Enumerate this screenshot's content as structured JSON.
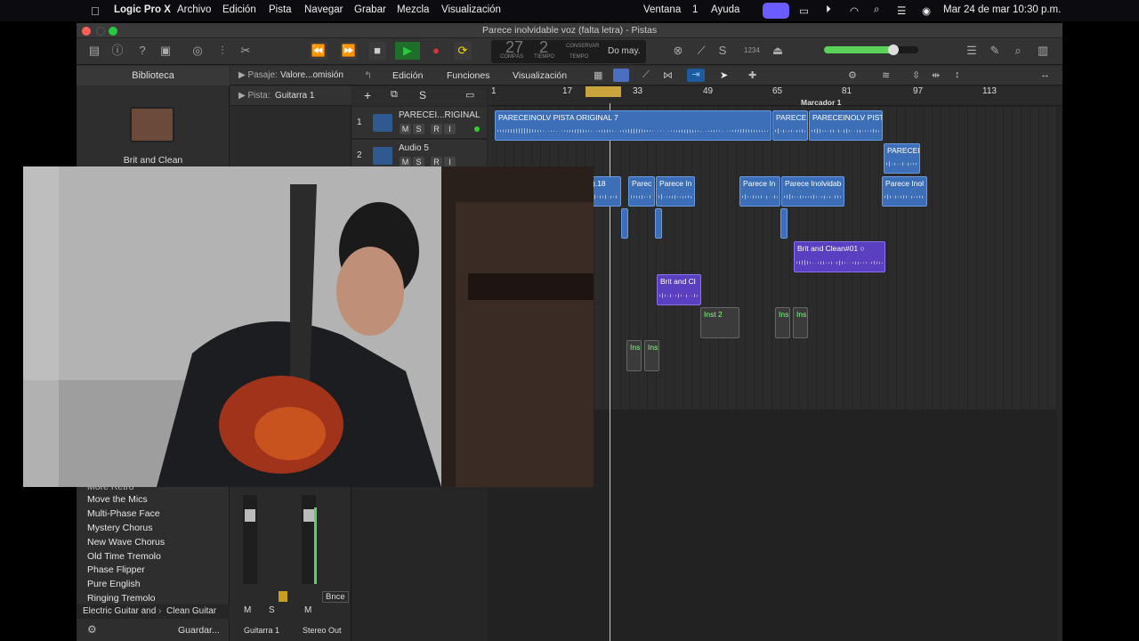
{
  "menubar": {
    "app": "Logic Pro X",
    "items": [
      "Archivo",
      "Edición",
      "Pista",
      "Navegar",
      "Grabar",
      "Mezcla",
      "Visualización",
      "Ventana",
      "1",
      "Ayuda"
    ],
    "datetime": "Mar 24 de mar  10:30 p.m."
  },
  "window": {
    "title": "Parece inolvidable voz (falta letra)  - Pistas"
  },
  "lcd": {
    "bar": "27",
    "beat": "2",
    "bar_label": "COMPÁS",
    "beat_label": "TIEMPO",
    "keep_label": "CONSERVAR",
    "tempo_label": "TEMPO",
    "key": "Do may.",
    "count": "1234"
  },
  "library": {
    "header": "Biblioteca",
    "selected_patch": "Brit and Clean",
    "items": [
      "Move the Mics",
      "Multi-Phase Face",
      "Mystery Chorus",
      "New Wave Chorus",
      "Old Time Tremolo",
      "Phase Flipper",
      "Pure English",
      "Ringing Tremolo"
    ],
    "partial_item": "More Retro",
    "breadcrumb": [
      "Electric Guitar and",
      "Clean Guitar"
    ],
    "save_label": "Guardar..."
  },
  "inspector": {
    "region_label": "Pasaje:",
    "region_value": "Valore...omisión",
    "track_label": "Pista:",
    "track_value": "Guitarra 1",
    "strip1": {
      "name": "Guitarra 1",
      "buttons": [
        "M",
        "S"
      ]
    },
    "strip2": {
      "name": "Stereo Out",
      "buttons": [
        "M"
      ],
      "bounce": "Bnce"
    }
  },
  "tracks_toolbar": {
    "menus": [
      "Edición",
      "Funciones",
      "Visualización"
    ]
  },
  "ruler": {
    "bars": [
      "1",
      "17",
      "33",
      "49",
      "65",
      "81",
      "97",
      "113"
    ],
    "marker": "Marcador 1"
  },
  "track_list": [
    {
      "num": "1",
      "name": "PARECEI...RIGINAL",
      "btns": [
        "M",
        "S",
        "R",
        "I"
      ]
    },
    {
      "num": "2",
      "name": "Audio 5",
      "btns": [
        "M",
        "S",
        "R",
        "I"
      ]
    }
  ],
  "regions": {
    "r1": "PARECEINOLV PISTA ORIGINAL 7",
    "r2": "PARECEI",
    "r3": "PARECEINOLV PIST",
    "r4": "PARECEI",
    "r5": ").18",
    "r6": "Parec",
    "r7": "Parece In",
    "r8": "Parece In",
    "r9": "Parece Inolvidab",
    "r10": "Parece Inol",
    "r11": "Brit and Clean#01",
    "r12": "Brit and Cl",
    "r13": "Inst 2",
    "r14": "Ins",
    "r15": "Ins",
    "r16": "Ins",
    "r17": "Ins"
  },
  "colors": {
    "region_blue": "#3d6fb8",
    "region_purple": "#5a3fc0",
    "play_green": "#27c93f",
    "record_red": "#e0303b",
    "menubar_accent": "#6b5cff"
  }
}
